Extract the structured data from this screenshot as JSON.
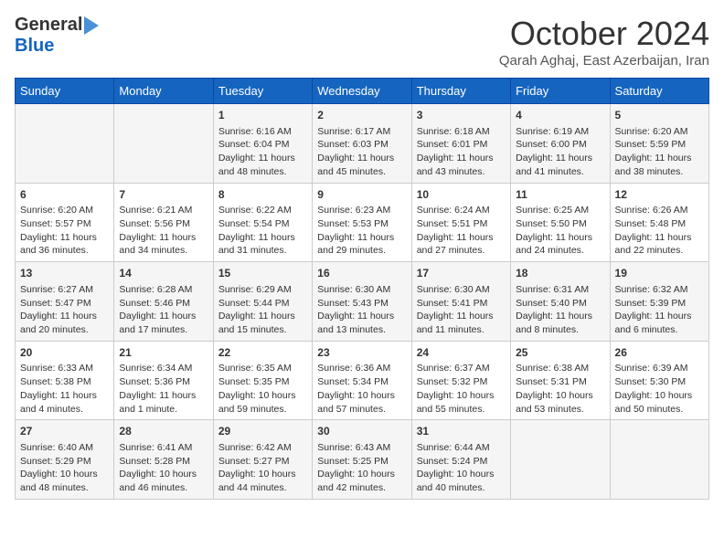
{
  "header": {
    "logo_general": "General",
    "logo_blue": "Blue",
    "month_title": "October 2024",
    "location": "Qarah Aghaj, East Azerbaijan, Iran"
  },
  "days_of_week": [
    "Sunday",
    "Monday",
    "Tuesday",
    "Wednesday",
    "Thursday",
    "Friday",
    "Saturday"
  ],
  "weeks": [
    [
      {
        "day": "",
        "sunrise": "",
        "sunset": "",
        "daylight": ""
      },
      {
        "day": "",
        "sunrise": "",
        "sunset": "",
        "daylight": ""
      },
      {
        "day": "1",
        "sunrise": "Sunrise: 6:16 AM",
        "sunset": "Sunset: 6:04 PM",
        "daylight": "Daylight: 11 hours and 48 minutes."
      },
      {
        "day": "2",
        "sunrise": "Sunrise: 6:17 AM",
        "sunset": "Sunset: 6:03 PM",
        "daylight": "Daylight: 11 hours and 45 minutes."
      },
      {
        "day": "3",
        "sunrise": "Sunrise: 6:18 AM",
        "sunset": "Sunset: 6:01 PM",
        "daylight": "Daylight: 11 hours and 43 minutes."
      },
      {
        "day": "4",
        "sunrise": "Sunrise: 6:19 AM",
        "sunset": "Sunset: 6:00 PM",
        "daylight": "Daylight: 11 hours and 41 minutes."
      },
      {
        "day": "5",
        "sunrise": "Sunrise: 6:20 AM",
        "sunset": "Sunset: 5:59 PM",
        "daylight": "Daylight: 11 hours and 38 minutes."
      }
    ],
    [
      {
        "day": "6",
        "sunrise": "Sunrise: 6:20 AM",
        "sunset": "Sunset: 5:57 PM",
        "daylight": "Daylight: 11 hours and 36 minutes."
      },
      {
        "day": "7",
        "sunrise": "Sunrise: 6:21 AM",
        "sunset": "Sunset: 5:56 PM",
        "daylight": "Daylight: 11 hours and 34 minutes."
      },
      {
        "day": "8",
        "sunrise": "Sunrise: 6:22 AM",
        "sunset": "Sunset: 5:54 PM",
        "daylight": "Daylight: 11 hours and 31 minutes."
      },
      {
        "day": "9",
        "sunrise": "Sunrise: 6:23 AM",
        "sunset": "Sunset: 5:53 PM",
        "daylight": "Daylight: 11 hours and 29 minutes."
      },
      {
        "day": "10",
        "sunrise": "Sunrise: 6:24 AM",
        "sunset": "Sunset: 5:51 PM",
        "daylight": "Daylight: 11 hours and 27 minutes."
      },
      {
        "day": "11",
        "sunrise": "Sunrise: 6:25 AM",
        "sunset": "Sunset: 5:50 PM",
        "daylight": "Daylight: 11 hours and 24 minutes."
      },
      {
        "day": "12",
        "sunrise": "Sunrise: 6:26 AM",
        "sunset": "Sunset: 5:48 PM",
        "daylight": "Daylight: 11 hours and 22 minutes."
      }
    ],
    [
      {
        "day": "13",
        "sunrise": "Sunrise: 6:27 AM",
        "sunset": "Sunset: 5:47 PM",
        "daylight": "Daylight: 11 hours and 20 minutes."
      },
      {
        "day": "14",
        "sunrise": "Sunrise: 6:28 AM",
        "sunset": "Sunset: 5:46 PM",
        "daylight": "Daylight: 11 hours and 17 minutes."
      },
      {
        "day": "15",
        "sunrise": "Sunrise: 6:29 AM",
        "sunset": "Sunset: 5:44 PM",
        "daylight": "Daylight: 11 hours and 15 minutes."
      },
      {
        "day": "16",
        "sunrise": "Sunrise: 6:30 AM",
        "sunset": "Sunset: 5:43 PM",
        "daylight": "Daylight: 11 hours and 13 minutes."
      },
      {
        "day": "17",
        "sunrise": "Sunrise: 6:30 AM",
        "sunset": "Sunset: 5:41 PM",
        "daylight": "Daylight: 11 hours and 11 minutes."
      },
      {
        "day": "18",
        "sunrise": "Sunrise: 6:31 AM",
        "sunset": "Sunset: 5:40 PM",
        "daylight": "Daylight: 11 hours and 8 minutes."
      },
      {
        "day": "19",
        "sunrise": "Sunrise: 6:32 AM",
        "sunset": "Sunset: 5:39 PM",
        "daylight": "Daylight: 11 hours and 6 minutes."
      }
    ],
    [
      {
        "day": "20",
        "sunrise": "Sunrise: 6:33 AM",
        "sunset": "Sunset: 5:38 PM",
        "daylight": "Daylight: 11 hours and 4 minutes."
      },
      {
        "day": "21",
        "sunrise": "Sunrise: 6:34 AM",
        "sunset": "Sunset: 5:36 PM",
        "daylight": "Daylight: 11 hours and 1 minute."
      },
      {
        "day": "22",
        "sunrise": "Sunrise: 6:35 AM",
        "sunset": "Sunset: 5:35 PM",
        "daylight": "Daylight: 10 hours and 59 minutes."
      },
      {
        "day": "23",
        "sunrise": "Sunrise: 6:36 AM",
        "sunset": "Sunset: 5:34 PM",
        "daylight": "Daylight: 10 hours and 57 minutes."
      },
      {
        "day": "24",
        "sunrise": "Sunrise: 6:37 AM",
        "sunset": "Sunset: 5:32 PM",
        "daylight": "Daylight: 10 hours and 55 minutes."
      },
      {
        "day": "25",
        "sunrise": "Sunrise: 6:38 AM",
        "sunset": "Sunset: 5:31 PM",
        "daylight": "Daylight: 10 hours and 53 minutes."
      },
      {
        "day": "26",
        "sunrise": "Sunrise: 6:39 AM",
        "sunset": "Sunset: 5:30 PM",
        "daylight": "Daylight: 10 hours and 50 minutes."
      }
    ],
    [
      {
        "day": "27",
        "sunrise": "Sunrise: 6:40 AM",
        "sunset": "Sunset: 5:29 PM",
        "daylight": "Daylight: 10 hours and 48 minutes."
      },
      {
        "day": "28",
        "sunrise": "Sunrise: 6:41 AM",
        "sunset": "Sunset: 5:28 PM",
        "daylight": "Daylight: 10 hours and 46 minutes."
      },
      {
        "day": "29",
        "sunrise": "Sunrise: 6:42 AM",
        "sunset": "Sunset: 5:27 PM",
        "daylight": "Daylight: 10 hours and 44 minutes."
      },
      {
        "day": "30",
        "sunrise": "Sunrise: 6:43 AM",
        "sunset": "Sunset: 5:25 PM",
        "daylight": "Daylight: 10 hours and 42 minutes."
      },
      {
        "day": "31",
        "sunrise": "Sunrise: 6:44 AM",
        "sunset": "Sunset: 5:24 PM",
        "daylight": "Daylight: 10 hours and 40 minutes."
      },
      {
        "day": "",
        "sunrise": "",
        "sunset": "",
        "daylight": ""
      },
      {
        "day": "",
        "sunrise": "",
        "sunset": "",
        "daylight": ""
      }
    ]
  ]
}
